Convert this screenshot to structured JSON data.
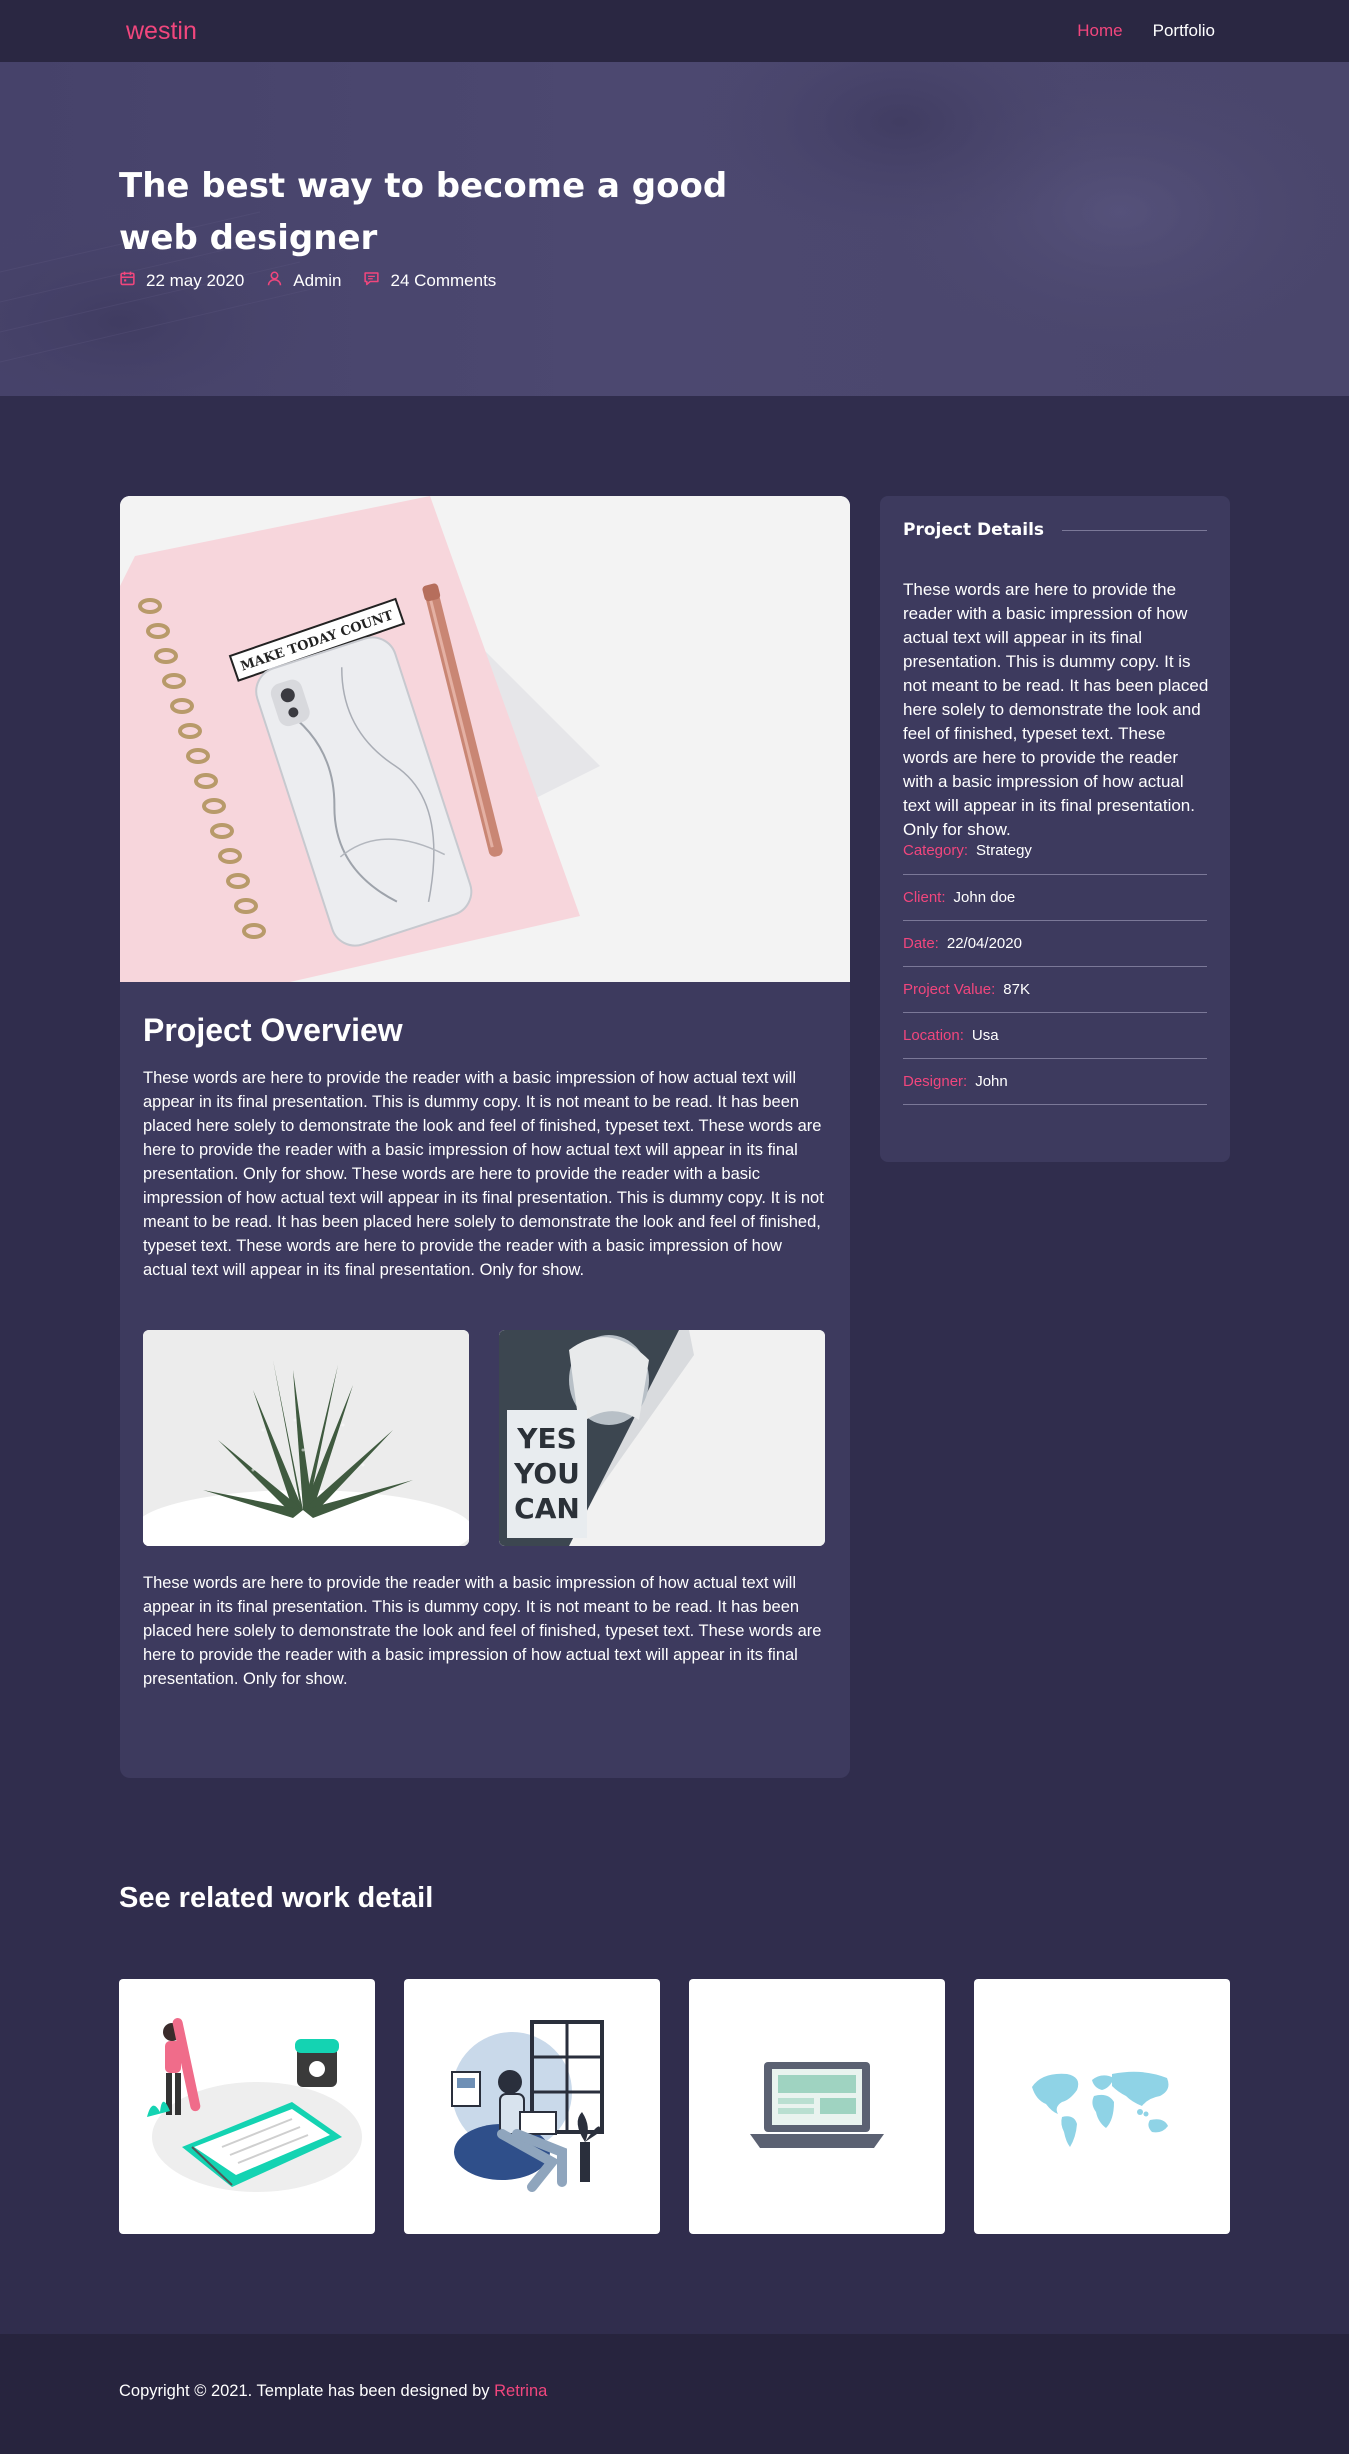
{
  "nav": {
    "brand": "westin",
    "links": [
      {
        "label": "Home",
        "active": true
      },
      {
        "label": "Portfolio",
        "active": false
      }
    ]
  },
  "hero": {
    "title": "The best way to become a good web designer",
    "meta": {
      "date": "22 may 2020",
      "author": "Admin",
      "comments": "24 Comments"
    },
    "icons": [
      "calendar-icon",
      "user-icon",
      "comment-icon"
    ]
  },
  "overview": {
    "main_image_text": "MAKE TODAY COUNT",
    "title": "Project Overview",
    "paragraph_1": "These words are here to provide the reader with a basic impression of how actual text will appear in its final presentation. This is dummy copy. It is not meant to be read. It has been placed here solely to demonstrate the look and feel of finished, typeset text. These words are here to provide the reader with a basic impression of how actual text will appear in its final presentation. Only for show. These words are here to provide the reader with a basic impression of how actual text will appear in its final presentation. This is dummy copy. It is not meant to be read. It has been placed here solely to demonstrate the look and feel of finished, typeset text. These words are here to provide the reader with a basic impression of how actual text will appear in its final presentation. Only for show.",
    "book_lines": [
      "YES",
      "YOU",
      "CAN"
    ],
    "paragraph_2": "These words are here to provide the reader with a basic impression of how actual text will appear in its final presentation. This is dummy copy. It is not meant to be read. It has been placed here solely to demonstrate the look and feel of finished, typeset text. These words are here to provide the reader with a basic impression of how actual text will appear in its final presentation. Only for show."
  },
  "project_details": {
    "title": "Project Details",
    "description": "These words are here to provide the reader with a basic impression of how actual text will appear in its final presentation. This is dummy copy. It is not meant to be read. It has been placed here solely to demonstrate the look and feel of finished, typeset text. These words are here to provide the reader with a basic impression of how actual text will appear in its final presentation. Only for show.",
    "rows": [
      {
        "label": "Category:",
        "value": "Strategy"
      },
      {
        "label": "Client:",
        "value": "John doe"
      },
      {
        "label": "Date:",
        "value": "22/04/2020"
      },
      {
        "label": "Project Value:",
        "value": "87K"
      },
      {
        "label": "Location:",
        "value": "Usa"
      },
      {
        "label": "Designer:",
        "value": "John"
      }
    ]
  },
  "related": {
    "title": "See related work detail"
  },
  "footer": {
    "text": "Copyright © 2021. Template has been designed by ",
    "link": "Retrina"
  },
  "colors": {
    "accent": "#f1467d",
    "background": "#302d4d",
    "card": "#3d3a5e",
    "nav": "#2a2742"
  }
}
